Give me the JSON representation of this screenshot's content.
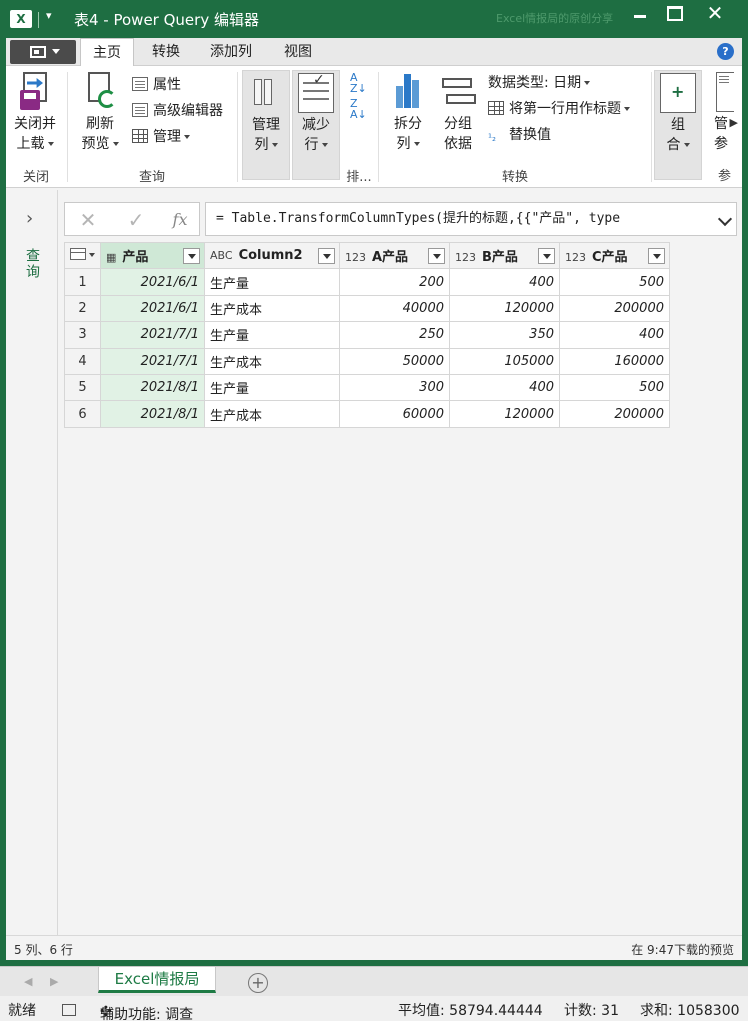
{
  "window": {
    "app_icon": "X",
    "title": "表4 - Power Query 编辑器",
    "ghost_text": "Excel情报局的原创分享"
  },
  "tabs": {
    "file": "file-menu-icon",
    "items": [
      "主页",
      "转换",
      "添加列",
      "视图"
    ],
    "active": "主页"
  },
  "ribbon": {
    "close_group": {
      "label": "关闭",
      "btn_line1": "关闭并",
      "btn_line2": "上载"
    },
    "query_group": {
      "label": "查询",
      "refresh_line1": "刷新",
      "refresh_line2": "预览",
      "properties": "属性",
      "advanced_editor": "高级编辑器",
      "manage": "管理"
    },
    "manage_cols": {
      "line1": "管理",
      "line2": "列"
    },
    "reduce_rows": {
      "line1": "减少",
      "line2": "行"
    },
    "sort_group": {
      "label": "排..."
    },
    "transform_group": {
      "label": "转换",
      "split_line1": "拆分",
      "split_line2": "列",
      "groupby_line1": "分组",
      "groupby_line2": "依据",
      "data_type": "数据类型: 日期",
      "first_row_header": "将第一行用作标题",
      "replace_values": "替换值"
    },
    "combine": {
      "line1": "组",
      "line2": "合"
    },
    "params": {
      "line1": "管",
      "line2": "参",
      "label": "参"
    }
  },
  "nav": {
    "label": "查询"
  },
  "formula": {
    "cancel_icon": "✕",
    "commit_icon": "✓",
    "fx_icon": "fx",
    "text": "= Table.TransformColumnTypes(提升的标题,{{\"产品\", type"
  },
  "table": {
    "columns": [
      {
        "type_icon": "▦",
        "name": "产品"
      },
      {
        "type_icon": "ABC",
        "name": "Column2"
      },
      {
        "type_icon": "123",
        "name": "A产品"
      },
      {
        "type_icon": "123",
        "name": "B产品"
      },
      {
        "type_icon": "123",
        "name": "C产品"
      }
    ],
    "rows": [
      [
        "1",
        "2021/6/1",
        "生产量",
        "200",
        "400",
        "500"
      ],
      [
        "2",
        "2021/6/1",
        "生产成本",
        "40000",
        "120000",
        "200000"
      ],
      [
        "3",
        "2021/7/1",
        "生产量",
        "250",
        "350",
        "400"
      ],
      [
        "4",
        "2021/7/1",
        "生产成本",
        "50000",
        "105000",
        "160000"
      ],
      [
        "5",
        "2021/8/1",
        "生产量",
        "300",
        "400",
        "500"
      ],
      [
        "6",
        "2021/8/1",
        "生产成本",
        "60000",
        "120000",
        "200000"
      ]
    ]
  },
  "status": {
    "left": "5 列、6 行",
    "right": "在 9:47下载的预览"
  },
  "excel": {
    "sheet_tab": "Excel情报局",
    "add_sheet": "+",
    "ready": "就绪",
    "accessibility": "辅助功能: 调查",
    "average": "平均值: 58794.44444",
    "count": "计数: 31",
    "sum": "求和: 1058300"
  }
}
